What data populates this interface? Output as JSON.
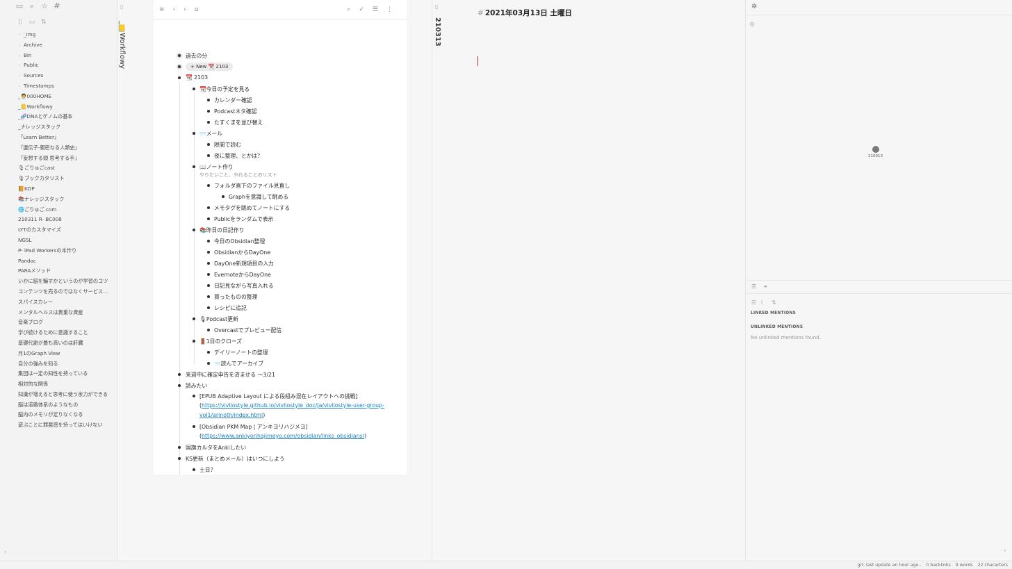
{
  "sidebar": {
    "icons": [
      "folder-icon",
      "search-icon",
      "star-icon",
      "tag-icon"
    ],
    "actions": [
      "new-note-icon",
      "new-folder-icon",
      "sort-icon"
    ],
    "folders": [
      "_img",
      "Archive",
      "Bin",
      "Public",
      "Sources",
      "Timestamps"
    ],
    "files": [
      "_🧑‍💼000HOME",
      "_📒Workflowy",
      "_🧬DNAとゲノムの基本",
      "_ナレッジスタック",
      "『Learn Better』",
      "『遺伝子-親密なる人類史』",
      "『妄想する頭 思考する手』",
      "🎙ごりゅごcast",
      "🎙ブックカタリスト",
      "📙KDP",
      "📚ナレッジスタック",
      "🌐ごりゅご.com",
      "210311 R- BC008",
      "LYTのカスタマイズ",
      "NGSL",
      "P- iPad Workersの本作り",
      "Pandoc",
      "PARAメソッド",
      "いかに脳を騙すかというのが学習のコツ",
      "コンテンツを売るのではなくサービス...",
      "スパイスカレー",
      "メンタルヘルスは貴重な資産",
      "音楽ブログ",
      "学び続けるために意識すること",
      "基礎代謝が最も高いのは肝臓",
      "月1のGraph View",
      "自分の強みを知る",
      "集団は一定の知性を持っている",
      "相対的な関係",
      "知識が増えると思考に使う余力ができる",
      "脳は道路体系のようなもの",
      "脳内のメモリが足りなくなる",
      "遊ぶことに罪悪感を持ってはいけない"
    ]
  },
  "tabs": {
    "workflowy": "_📒Workflowy",
    "daily": "210313"
  },
  "outline": {
    "items": [
      "過去の分",
      "+ New 📆 2103",
      "📆 2103",
      "📆今日の予定を見る",
      "カレンダー確認",
      "Podcastネタ確認",
      "たすくまを並び替え",
      "📨メール",
      "隙間で読む",
      "夜に整理、とかは？",
      "📖ノート作り",
      "フォルダ直下のファイル見直し",
      "Graphを意識して眺める",
      "メモタグを眺めてノートにする",
      "Publicをランダムで表示",
      "📚昨日の日記作り",
      "今日のObsidian整理",
      "ObsidianからDayOne",
      "DayOne新規項目の入力",
      "EvernoteからDayOne",
      "日記見ながら写真入れる",
      "買ったものの整理",
      "レシピに追記",
      "🎙Podcast更新",
      "Overcastでプレビュー配信",
      "🚪1日のクローズ",
      "デイリーノートの整理",
      "📨読んでアーカイブ",
      "来週中に確定申告を済ませる 〜3/21",
      "読みたい",
      "国旗カルタをAnkiしたい",
      "KS更新（まとめメール）はいつにしよう",
      "土日？"
    ],
    "note_text": "やりたいこと、やれることのリスト",
    "epub_title": "[EPUB Adaptive Layout による段組み混在レイアウトへの挑戦]",
    "epub_url_open": "(",
    "epub_url_1": "https://vivliostyle.github.io/vivliostyle_doc/ja/vivliostyle-user-group-",
    "epub_url_2": "vol1/arinoth/index.html",
    "epub_url_close": ")",
    "pkm_title": "[Obsidian PKM Map | アンキヨリハジメヨ]",
    "pkm_url_open": "(",
    "pkm_url": "https://www.ankiyorihajimeyo.com/obsidian/links_obsidians/",
    "pkm_url_close": ")"
  },
  "note": {
    "hash": "#",
    "title": "2021年03月13日 土曜日"
  },
  "right": {
    "graph_node": "210313",
    "linked_mentions": "LINKED MENTIONS",
    "unlinked_mentions": "UNLINKED MENTIONS",
    "no_unlinked": "No unlinked mentions found."
  },
  "status": {
    "git": "git: last update an hour ago..",
    "backlinks": "0 backlinks",
    "words": "9 words",
    "characters": "22 characters"
  },
  "colors": {
    "accent": "#c62828",
    "link": "#1b7fbf"
  }
}
